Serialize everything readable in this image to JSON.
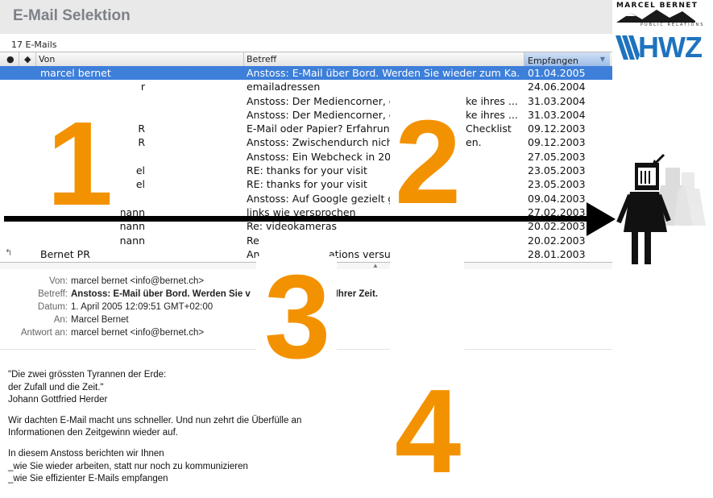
{
  "header": {
    "title": "E-Mail Selektion"
  },
  "logos": {
    "marcel_bernet": {
      "name": "MARCEL BERNET",
      "tagline": "PUBLIC RELATIONS"
    },
    "hwz": {
      "name": "HWZ"
    }
  },
  "mail_list": {
    "count_label": "17 E-Mails",
    "columns": {
      "von": "Von",
      "betreff": "Betreff",
      "empfangen": "Empfangen"
    },
    "rows": [
      {
        "von": "marcel bernet",
        "betreff": "Anstoss: E-Mail über Bord. Werden Sie wieder zum Ka...",
        "datum": "01.04.2005",
        "selected": true
      },
      {
        "von": "r",
        "betreff": "emailadressen",
        "datum": "24.06.2004"
      },
      {
        "von": "",
        "betreff": "Anstoss: Der Mediencorner, d",
        "betreff_tail": "ke ihres ...",
        "datum": "31.03.2004"
      },
      {
        "von": "",
        "betreff": "Anstoss: Der Mediencorner, d",
        "betreff_tail": "ke ihres ...",
        "datum": "31.03.2004"
      },
      {
        "von": "R",
        "betreff": "E-Mail oder Papier? Erfahrung",
        "betreff_tail": "Checklist",
        "datum": "09.12.2003"
      },
      {
        "von": "R",
        "betreff": "Anstoss: Zwischendurch nicht",
        "betreff_tail": "en.",
        "datum": "09.12.2003"
      },
      {
        "von": "",
        "betreff": "Anstoss: Ein Webcheck in 20 M",
        "datum": "27.05.2003"
      },
      {
        "von": "el",
        "betreff": "RE: thanks for your visit",
        "datum": "23.05.2003"
      },
      {
        "von": "el",
        "betreff": "RE: thanks for your visit",
        "datum": "23.05.2003"
      },
      {
        "von": "",
        "betreff": "Anstoss: Auf Google gezielt g",
        "datum": "09.04.2003"
      },
      {
        "von": "nann",
        "betreff": "links wie versprochen",
        "datum": "27.02.2003"
      },
      {
        "von": "nann",
        "betreff": "Re: videokameras",
        "datum": "20.02.2003"
      },
      {
        "von": "nann",
        "betreff": "Re",
        "datum": "20.02.2003"
      },
      {
        "von": "Bernet PR",
        "betreff": "An",
        "betreff_tail": "ations versus Werbung",
        "datum": "28.01.2003",
        "replied": true
      }
    ]
  },
  "message": {
    "labels": {
      "von": "Von:",
      "betreff": "Betreff:",
      "datum": "Datum:",
      "an": "An:",
      "antwort": "Antwort an:"
    },
    "von": "marcel bernet <info@bernet.ch>",
    "betreff_start": "Anstoss: E-Mail über Bord. Werden Sie v",
    "betreff_end": "än Ihrer Zeit.",
    "datum": "1. April 2005 12:09:51 GMT+02:00",
    "an": "Marcel Bernet",
    "antwort": "marcel bernet <info@bernet.ch>",
    "body": {
      "quote_1": "\"Die zwei grössten Tyrannen der Erde:",
      "quote_2": "der Zufall und die Zeit.\"",
      "quote_author": "Johann Gottfried Herder",
      "para_1": "Wir dachten E-Mail macht uns schneller. Und nun zehrt die Überfülle an",
      "para_2": "Informationen den Zeitgewinn wieder auf.",
      "para_3": "In diesem Anstoss berichten wir Ihnen",
      "bullet_1": "_wie Sie wieder arbeiten, statt nur noch zu kommunizieren",
      "bullet_2": "_wie Sie effizienter E-Mails empfangen"
    }
  },
  "overlay": {
    "numbers": [
      "1",
      "2",
      "3",
      "4"
    ],
    "number_color": "#f39200",
    "arrow_color": "#000000",
    "figure": "person-reading-mail-icon"
  }
}
